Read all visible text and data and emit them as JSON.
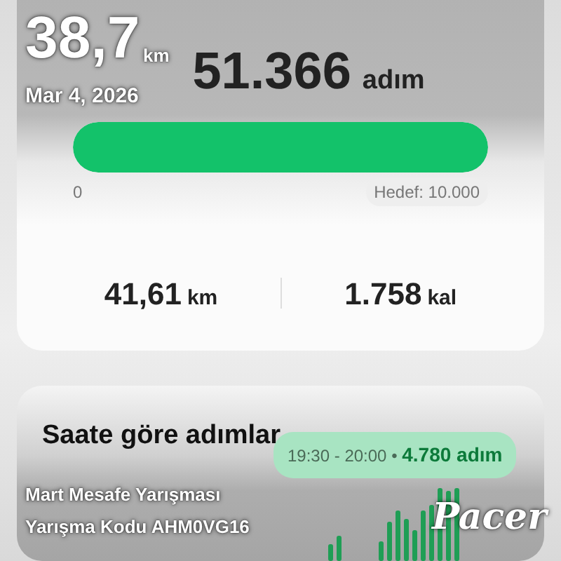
{
  "overlay": {
    "distance": "38,7",
    "distance_unit": "km",
    "date": "Mar 4, 2026",
    "challenge": "Mart Mesafe Yarışması",
    "code": "Yarışma Kodu AHM0VG16",
    "brand": "Pacer"
  },
  "steps": {
    "value": "51.366",
    "unit": "adım",
    "level": 1,
    "min": "0",
    "goal": "Hedef: 10.000"
  },
  "stats": [
    {
      "value": "41,61",
      "unit": "km"
    },
    {
      "value": "1.758",
      "unit": "kal"
    }
  ],
  "hourly": {
    "title": "Saate göre adımlar",
    "tooltip_time": "19:30 - 20:00",
    "tooltip_sep": "•",
    "tooltip_value": "4.780 adım"
  }
}
